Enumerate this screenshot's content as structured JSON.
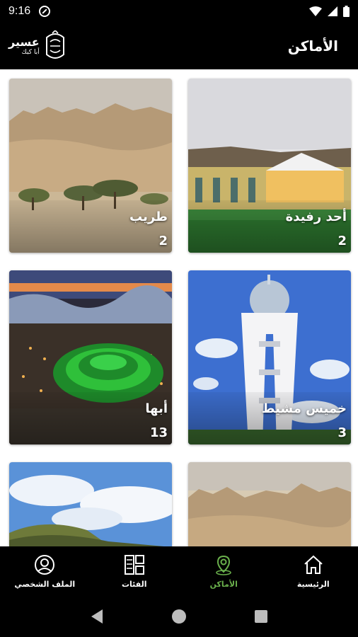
{
  "status_bar": {
    "time": "9:16"
  },
  "header": {
    "title": "الأماكن",
    "logo_line1": "عسير",
    "logo_line2": "أبا كبك"
  },
  "places": [
    {
      "name": "طريب",
      "count": "2"
    },
    {
      "name": "أحد رفيدة",
      "count": "2"
    },
    {
      "name": "أبها",
      "count": "13"
    },
    {
      "name": "خميس مشيط",
      "count": "3"
    },
    {
      "name": "",
      "count": ""
    },
    {
      "name": "",
      "count": ""
    }
  ],
  "bottom_nav": {
    "items": [
      {
        "label": "الملف الشخصي",
        "icon": "profile-icon"
      },
      {
        "label": "الفئات",
        "icon": "categories-icon"
      },
      {
        "label": "الأماكن",
        "icon": "places-icon"
      },
      {
        "label": "الرئيسية",
        "icon": "home-icon"
      }
    ],
    "active_index": 2
  },
  "colors": {
    "accent": "#6ab04c",
    "bar": "#000000"
  }
}
